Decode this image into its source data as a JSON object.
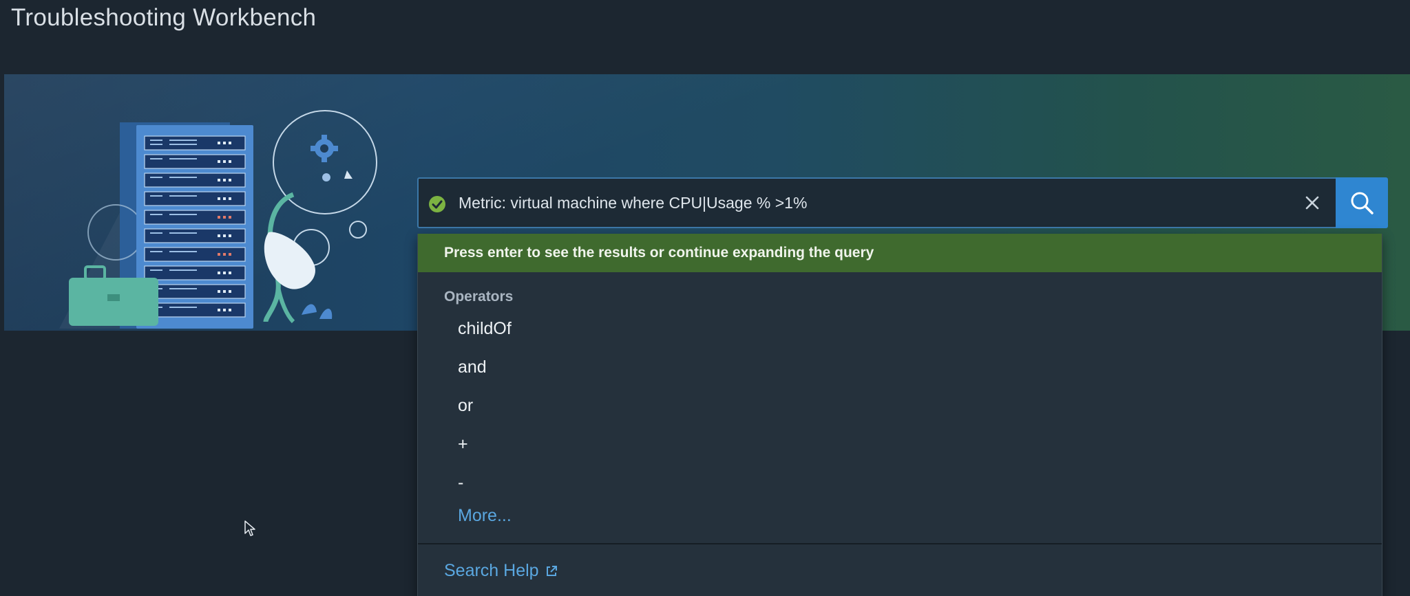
{
  "page": {
    "title": "Troubleshooting Workbench"
  },
  "search": {
    "query": "Metric: virtual machine where CPU|Usage % >1%",
    "status_icon": "check-circle-icon",
    "clear_icon": "close-icon",
    "search_icon": "search-icon"
  },
  "dropdown": {
    "hint": "Press enter to see the results or continue expanding the query",
    "operators_header": "Operators",
    "operators": [
      {
        "label": "childOf"
      },
      {
        "label": "and"
      },
      {
        "label": "or"
      },
      {
        "label": "+"
      },
      {
        "label": "-"
      }
    ],
    "more_label": "More...",
    "help_label": "Search Help",
    "help_icon": "external-link-icon"
  },
  "colors": {
    "accent": "#2f86d1",
    "hint_background": "#3f6a2e",
    "link": "#5aa7e0",
    "success": "#7cb342"
  }
}
